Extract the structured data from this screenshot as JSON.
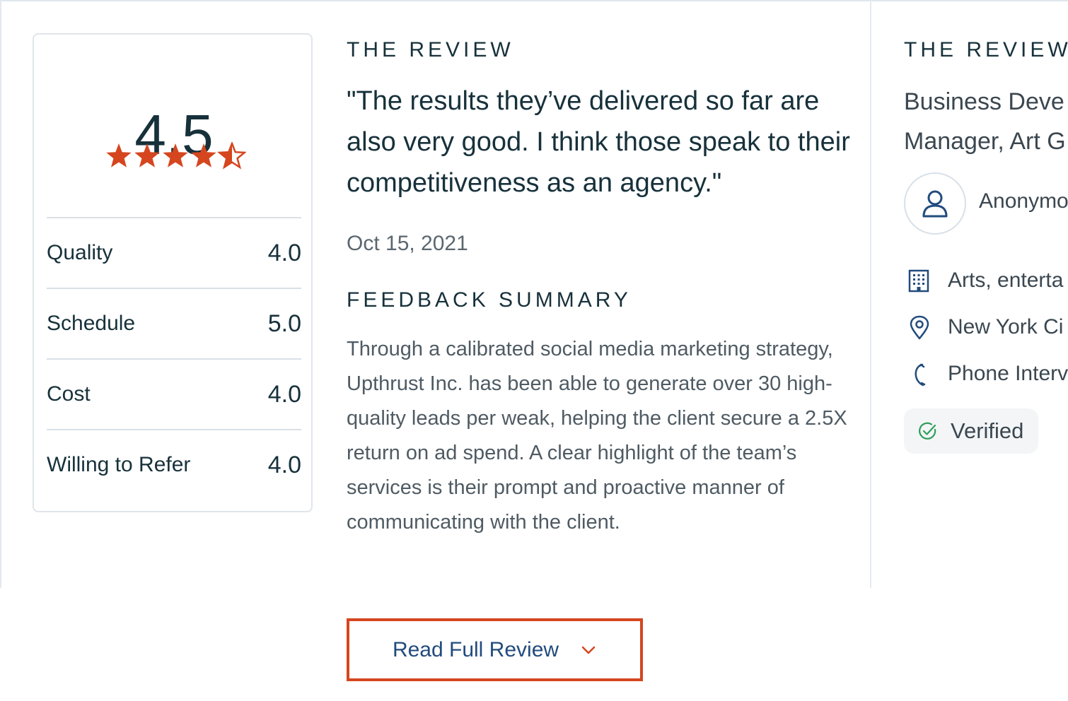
{
  "rating": {
    "overall": "4.5",
    "stars": 4.5,
    "star_color": "#d5461f",
    "metrics": [
      {
        "label": "Quality",
        "value": "4.0"
      },
      {
        "label": "Schedule",
        "value": "5.0"
      },
      {
        "label": "Cost",
        "value": "4.0"
      },
      {
        "label": "Willing to Refer",
        "value": "4.0"
      }
    ]
  },
  "review": {
    "heading": "THE REVIEW",
    "quote": "\"The results they’ve delivered so far are also very good. I think those speak to their competitiveness as an agency.\"",
    "date": "Oct 15, 2021",
    "summary_heading": "FEEDBACK SUMMARY",
    "summary": "Through a calibrated social media marketing strategy, Upthrust Inc. has been able to generate over 30 high-quality leads per weak, helping the client secure a 2.5X return on ad spend. A clear highlight of the team’s services is their prompt and proactive manner of communicating with the client.",
    "read_more_label": "Read Full Review",
    "read_more_icon": "chevron-down-icon"
  },
  "reviewer": {
    "heading": "THE REVIEWE",
    "title_line1": "Business Deve",
    "title_line2": "Manager, Art G",
    "name": "Anonymo",
    "details": [
      {
        "icon": "building-icon",
        "text": "Arts, enterta"
      },
      {
        "icon": "location-pin-icon",
        "text": "New York Ci"
      },
      {
        "icon": "phone-icon",
        "text": "Phone Interv"
      }
    ],
    "verified_label": "Verified",
    "accent_color": "#224b7d",
    "verified_color": "#2f9e5a"
  }
}
